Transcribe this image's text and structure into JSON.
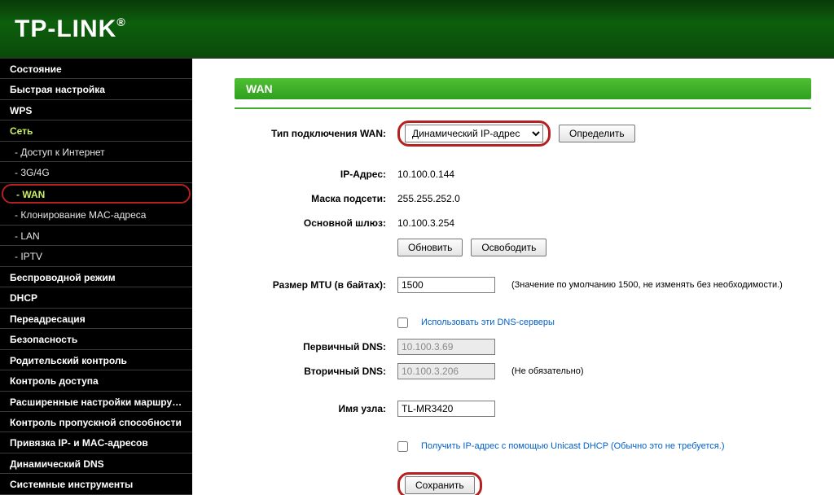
{
  "brand": "TP-LINK",
  "sidebar": {
    "items": [
      {
        "label": "Состояние",
        "type": "top"
      },
      {
        "label": "Быстрая настройка",
        "type": "top"
      },
      {
        "label": "WPS",
        "type": "top"
      },
      {
        "label": "Сеть",
        "type": "top-active"
      },
      {
        "label": "- Доступ к Интернет",
        "type": "sub"
      },
      {
        "label": "- 3G/4G",
        "type": "sub"
      },
      {
        "label": "- WAN",
        "type": "sub-current"
      },
      {
        "label": "- Клонирование MAC-адреса",
        "type": "sub"
      },
      {
        "label": "- LAN",
        "type": "sub"
      },
      {
        "label": "- IPTV",
        "type": "sub"
      },
      {
        "label": "Беспроводной режим",
        "type": "top"
      },
      {
        "label": "DHCP",
        "type": "top"
      },
      {
        "label": "Переадресация",
        "type": "top"
      },
      {
        "label": "Безопасность",
        "type": "top"
      },
      {
        "label": "Родительский контроль",
        "type": "top"
      },
      {
        "label": "Контроль доступа",
        "type": "top"
      },
      {
        "label": "Расширенные настройки маршрутизации",
        "type": "top"
      },
      {
        "label": "Контроль пропускной способности",
        "type": "top"
      },
      {
        "label": "Привязка IP- и MAC-адресов",
        "type": "top"
      },
      {
        "label": "Динамический DNS",
        "type": "top"
      },
      {
        "label": "Системные инструменты",
        "type": "top"
      }
    ]
  },
  "page": {
    "title": "WAN",
    "labels": {
      "conn_type": "Тип подключения WAN:",
      "ip": "IP-Адрес:",
      "mask": "Маска подсети:",
      "gw": "Основной шлюз:",
      "mtu": "Размер MTU (в байтах):",
      "dns1": "Первичный DNS:",
      "dns2": "Вторичный DNS:",
      "host": "Имя узла:"
    },
    "values": {
      "ip": "10.100.0.144",
      "mask": "255.255.252.0",
      "gw": "10.100.3.254",
      "mtu": "1500",
      "dns1": "10.100.3.69",
      "dns2": "10.100.3.206",
      "host": "TL-MR3420"
    },
    "select": {
      "conn_type_selected": "Динамический IP-адрес"
    },
    "buttons": {
      "detect": "Определить",
      "renew": "Обновить",
      "release": "Освободить",
      "save": "Сохранить"
    },
    "notes": {
      "mtu": "(Значение по умолчанию 1500, не изменять без необходимости.)",
      "dns2": "(Не обязательно)"
    },
    "checkbox_labels": {
      "use_dns": "Использовать эти DNS-серверы",
      "unicast": "Получить IP-адрес с помощью Unicast DHCP (Обычно это не требуется.)"
    }
  }
}
